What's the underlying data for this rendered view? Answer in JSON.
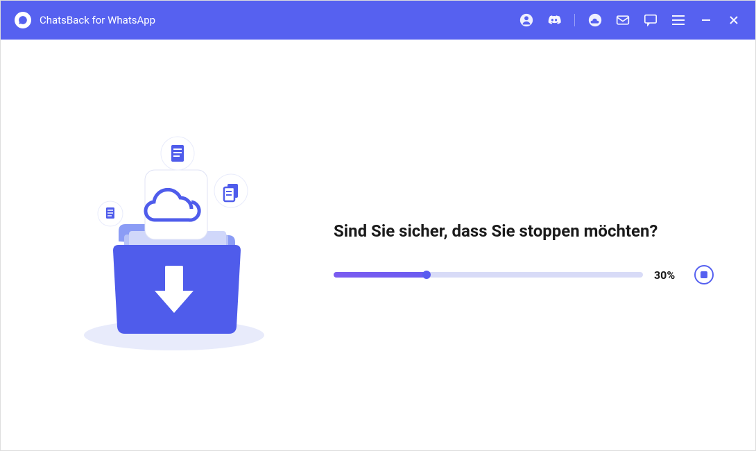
{
  "header": {
    "title": "ChatsBack for WhatsApp"
  },
  "main": {
    "prompt": "Sind Sie sicher, dass Sie stoppen möchten?",
    "progress_percent": 30,
    "progress_label": "30%"
  },
  "colors": {
    "accent": "#5661f0",
    "progress_fill": "#7b5cf0",
    "progress_track": "#d8dbf7"
  }
}
